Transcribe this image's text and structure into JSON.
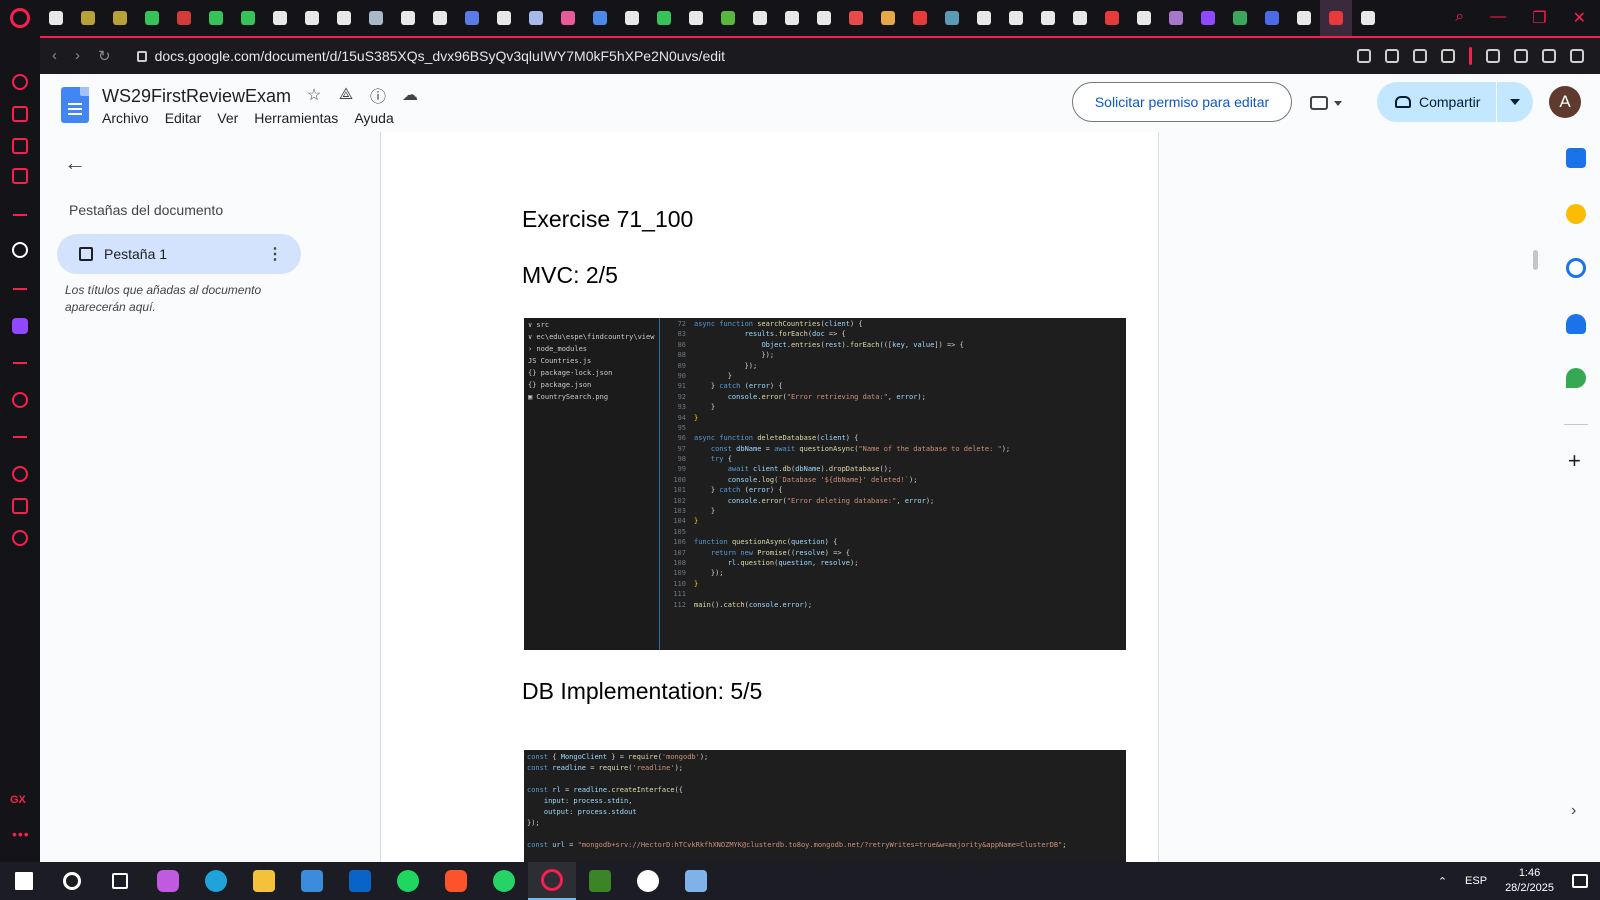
{
  "browser": {
    "url": "docs.google.com/document/d/15uS385XQs_dvx96BSyQv3qluIWY7M0kF5hXPe2N0uvs/edit",
    "tab_colors": [
      "#e8e8e8",
      "#b8a13a",
      "#b8a13a",
      "#3ac25a",
      "#d33a3a",
      "#3ac25a",
      "#3ac25a",
      "#e8e8e8",
      "#e8e8e8",
      "#e8e8e8",
      "#a8b8c8",
      "#e8e8e8",
      "#e8e8e8",
      "#5a7ae8",
      "#e8e8e8",
      "#a8b8e8",
      "#e85a9a",
      "#4a8ae8",
      "#e8e8e8",
      "#3ac25a",
      "#e8e8e8",
      "#5ab83a",
      "#e8e8e8",
      "#e8e8e8",
      "#e8e8e8",
      "#e84a4a",
      "#e8a84a",
      "#e83a3a",
      "#5a9ab8",
      "#e8e8e8",
      "#e8e8e8",
      "#e8e8e8",
      "#e8e8e8",
      "#e83a3a",
      "#e8e8e8",
      "#a878c8",
      "#9146ff",
      "#3aa85a",
      "#4a6ae8",
      "#e8e8e8",
      "#e83a3a",
      "#e8e8e8"
    ]
  },
  "docs": {
    "title": "WS29FirstReviewExam",
    "menu": [
      "Archivo",
      "Editar",
      "Ver",
      "Herramientas",
      "Ayuda"
    ],
    "request_edit": "Solicitar permiso para editar",
    "share": "Compartir",
    "avatar_letter": "A"
  },
  "outline": {
    "title": "Pestañas del documento",
    "tab_label": "Pestaña 1",
    "hint": "Los títulos que añadas al documento aparecerán aquí."
  },
  "document": {
    "h_exercise": "Exercise 71_100",
    "h_mvc": "MVC: 2/5",
    "h_db": "DB Implementation: 5/5",
    "explorer": [
      "∨ src",
      "  ∨ ec\\edu\\espe\\findcountry\\view",
      "    › node_modules",
      "    JS Countries.js",
      "  {} package-lock.json",
      "  {} package.json",
      "  ▣ CountrySearch.png"
    ]
  },
  "taskbar": {
    "lang": "ESP",
    "time": "1:46",
    "date": "28/2/2025"
  }
}
